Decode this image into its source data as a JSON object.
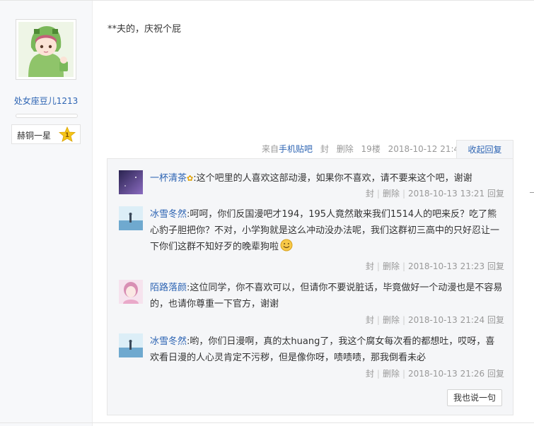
{
  "author": {
    "username": "处女座豆儿1213",
    "level_name": "赫铜一星",
    "level_number": "1"
  },
  "post": {
    "content": "**夫的，庆祝个屁",
    "tail": {
      "from_prefix": "来自",
      "from_link": "手机贴吧",
      "block": "封",
      "delete": "删除",
      "floor": "19楼",
      "time": "2018-10-12 21:45"
    },
    "collapse_label": "收起回复"
  },
  "replies": [
    {
      "user": "一杯清茶",
      "separator": ":",
      "text": "这个吧里的人喜欢这部动漫，如果你不喜欢，请不要来这个吧，谢谢",
      "block": "封",
      "delete": "删除",
      "time": "2018-10-13 13:21",
      "reply": "回复"
    },
    {
      "user": "冰雪冬然",
      "separator": ":",
      "text": "呵呵，你们反国漫吧才194，195人竟然敢来我们1514人的吧来反？吃了熊心豹子胆把你？不对，小学狗就是这么冲动没办法呢，我们这群初三高中的只好忍让一下你们这群不知好歹的晚辈狗啦",
      "block": "封",
      "delete": "删除",
      "time": "2018-10-13 21:23",
      "reply": "回复"
    },
    {
      "user": "陌路落颜",
      "separator": ":",
      "text": "这位同学，你不喜欢可以，但请你不要说脏话，毕竟做好一个动漫也是不容易的，也请你尊重一下官方，谢谢",
      "block": "封",
      "delete": "删除",
      "time": "2018-10-13 21:24",
      "reply": "回复"
    },
    {
      "user": "冰雪冬然",
      "separator": ":",
      "text": "哟，你们日漫啊，真的太huang了，我这个腐女每次看的都想吐，哎呀，喜欢看日漫的人心灵肯定不污秽，但是像你呀，啧啧啧，那我倒看未必",
      "block": "封",
      "delete": "删除",
      "time": "2018-10-13 21:26",
      "reply": "回复"
    }
  ],
  "say_button": "我也说一句",
  "colors": {
    "link": "#2d64b3",
    "meta": "#999999",
    "reply_bg": "#f5f6f8",
    "star": "#f5c518"
  }
}
